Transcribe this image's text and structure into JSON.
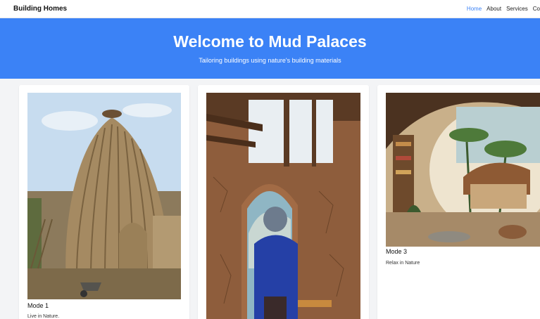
{
  "navbar": {
    "brand": "Building Homes",
    "links": [
      "Home",
      "About",
      "Services",
      "Co"
    ]
  },
  "hero": {
    "title": "Welcome to Mud Palaces",
    "subtitle": "Tailoring buildings using nature's building materials"
  },
  "cards": [
    {
      "title": "Mode 1",
      "description": "Live in Nature."
    },
    {
      "title": "",
      "description": ""
    },
    {
      "title": "Mode 3",
      "description": "Relax in Nature"
    }
  ],
  "colors": {
    "accent": "#3b82f6",
    "background": "#f3f4f6"
  }
}
